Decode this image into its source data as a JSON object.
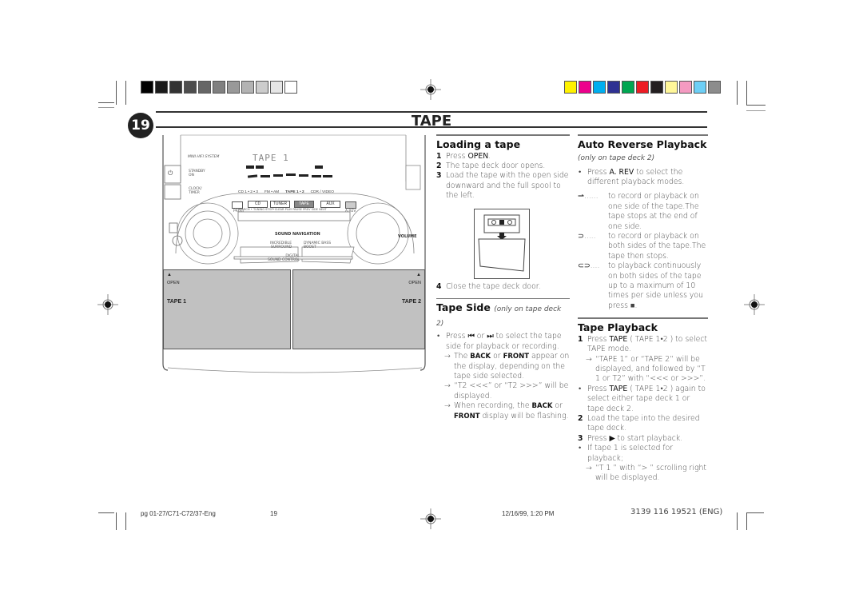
{
  "page": {
    "number": "19",
    "title": "TAPE"
  },
  "color_bars": {
    "grayscale": [
      "#000000",
      "#1a1a1a",
      "#333333",
      "#4d4d4d",
      "#666666",
      "#808080",
      "#999999",
      "#b3b3b3",
      "#cccccc",
      "#e6e6e6",
      "#ffffff"
    ],
    "process": [
      "#fff200",
      "#ec008c",
      "#00aeef",
      "#2e3192",
      "#00a651",
      "#ed1c24",
      "#231f20",
      "#fff799",
      "#f49ac1",
      "#6dcff6",
      "#8c8c8c"
    ]
  },
  "figure": {
    "brand_label": "MINI HIFI SYSTEM",
    "standby_label": "STANDBY\nON",
    "clock_label": "CLOCK/\nTIMER",
    "display_text": "TAPE  1",
    "source_labels": [
      "CD 1 • 2 • 3",
      "FM • AM",
      "TAPE 1 • 2",
      "CDR / VIDEO"
    ],
    "buttons": [
      "CD",
      "TUNER",
      "TAPE",
      "AUX"
    ],
    "prog_label": "PROG",
    "arev_label": "A.REV",
    "transport_labels": "SEARCH • TUNING   STOP•CLEAR  PLAY  PAUSE   PREV  SIDE  NEXT",
    "sound_navigation": "SOUND NAVIGATION",
    "incredible_surround": "INCREDIBLE\nSURROUND",
    "dynamic_bass": "DYNAMIC BASS\nBOOST",
    "digital_sound": "DIGITAL\nSOUND CONTROL",
    "volume": "VOLUME",
    "open_left": "OPEN",
    "open_right": "OPEN",
    "tape1": "TAPE 1",
    "tape2": "TAPE 2"
  },
  "loading": {
    "heading": "Loading a tape",
    "steps": [
      {
        "n": "1",
        "pre": "Press ",
        "bold": "OPEN",
        "post": "."
      },
      {
        "n": "2",
        "text": "The tape deck door opens."
      },
      {
        "n": "3",
        "text": "Load the tape with the open side downward and the full spool to the left."
      },
      {
        "n": "4",
        "text": "Close the tape deck door."
      }
    ]
  },
  "tape_side": {
    "heading": "Tape Side",
    "heading_sub": "(only on tape deck 2)",
    "bullet_pre": "Press ",
    "bullet_icon1": "⏮",
    "bullet_mid": " or ",
    "bullet_icon2": "⏭",
    "bullet_post": " to select the tape side for playback or recording.",
    "arrows": [
      {
        "pre": "The ",
        "sc1": "BACK",
        "mid": " or ",
        "sc2": "FRONT",
        "post": " appear on the display, depending on the tape side selected."
      },
      {
        "text": "“T2  <<<” or “T2  >>>” will be displayed."
      },
      {
        "pre": "When recording, the ",
        "sc1": "BACK",
        "mid": " or ",
        "sc2": "FRONT",
        "post": " display will be flashing."
      }
    ]
  },
  "auto_reverse": {
    "heading": "Auto Reverse Playback",
    "heading_sub": "(only on tape deck 2)",
    "bullet_pre": "Press ",
    "bullet_bold": "A. REV",
    "bullet_post": " to select the different playback modes.",
    "modes": [
      {
        "icon": "one-side-icon",
        "glyph": "⇀",
        "dots": "......",
        "text": "to record or playback on one side of the tape.The tape stops at the end of one side."
      },
      {
        "icon": "both-sides-icon",
        "glyph": "⊃",
        "dots": ".....",
        "text": "to record or playback on both sides of the tape.The tape then stops."
      },
      {
        "icon": "continuous-icon",
        "glyph": "⊂⊃",
        "dots": "....",
        "text": "to playback continuously on both sides of the tape up to a maximum of 10 times per side unless you press ■."
      }
    ]
  },
  "tape_playback": {
    "heading": "Tape Playback",
    "step1": {
      "n": "1",
      "pre": "Press ",
      "bold": "TAPE",
      "post": " ( TAPE 1•2 ) to select TAPE mode."
    },
    "step1_arrow": "“TAPE  1” or “TAPE  2” will be displayed,  and followed by “T 1 or T2” with “<<< or >>>”.",
    "bullet1": {
      "pre": "Press ",
      "bold": "TAPE",
      "post": " ( TAPE 1•2 ) again to select either tape deck 1 or tape deck 2."
    },
    "step2": {
      "n": "2",
      "text": "Load the tape into the desired tape deck."
    },
    "step3": {
      "n": "3",
      "pre": "Press ",
      "icon": "▶",
      "post": " to start playback."
    },
    "bullet2": "If tape 1 is selected for playback;",
    "bullet2_arrow": "“T 1 ” with “> ” scrolling right will be displayed."
  },
  "footer": {
    "file": "pg 01-27/C71-C72/37-Eng",
    "page": "19",
    "datetime": "12/16/99, 1:20 PM",
    "code": "3139 116 19521 (ENG)"
  }
}
